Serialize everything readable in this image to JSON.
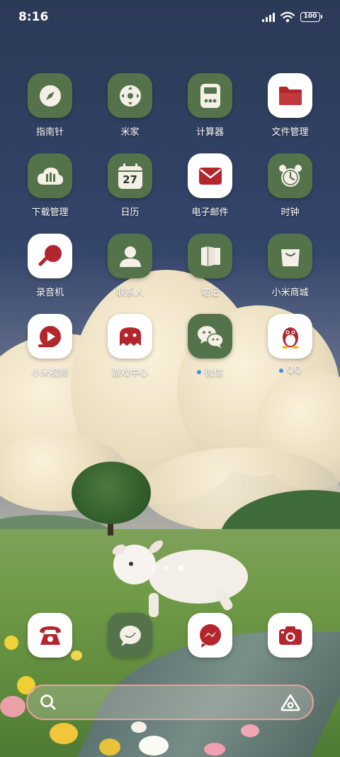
{
  "status_bar": {
    "time": "8:16",
    "battery": "100",
    "icons": [
      "signal-icon",
      "wifi-icon",
      "battery-icon"
    ]
  },
  "apps": [
    {
      "label": "指南针",
      "icon": "compass-icon",
      "style": "green"
    },
    {
      "label": "米家",
      "icon": "mijia-icon",
      "style": "green"
    },
    {
      "label": "计算器",
      "icon": "calculator-icon",
      "style": "green"
    },
    {
      "label": "文件管理",
      "icon": "folder-icon",
      "style": "white"
    },
    {
      "label": "下载管理",
      "icon": "download-cloud-icon",
      "style": "green"
    },
    {
      "label": "日历",
      "icon": "calendar-icon",
      "style": "green",
      "icon_text": "27"
    },
    {
      "label": "电子邮件",
      "icon": "mail-icon",
      "style": "white"
    },
    {
      "label": "时钟",
      "icon": "alarm-clock-icon",
      "style": "green"
    },
    {
      "label": "录音机",
      "icon": "microphone-icon",
      "style": "white"
    },
    {
      "label": "联系人",
      "icon": "contact-icon",
      "style": "green"
    },
    {
      "label": "笔记",
      "icon": "notes-icon",
      "style": "green"
    },
    {
      "label": "小米商城",
      "icon": "shopping-bag-icon",
      "style": "green"
    },
    {
      "label": "小米视频",
      "icon": "video-play-icon",
      "style": "white"
    },
    {
      "label": "游戏中心",
      "icon": "game-ghost-icon",
      "style": "white"
    },
    {
      "label": "微信",
      "icon": "wechat-icon",
      "style": "green",
      "new_dot": true
    },
    {
      "label": "QQ",
      "icon": "qq-penguin-icon",
      "style": "white",
      "new_dot": true
    }
  ],
  "page_indicator": {
    "pages": 2,
    "active_page": 2
  },
  "dock": [
    {
      "icon": "phone-icon",
      "style": "white"
    },
    {
      "icon": "message-bubble-icon",
      "style": "green"
    },
    {
      "icon": "messenger-icon",
      "style": "white"
    },
    {
      "icon": "camera-icon",
      "style": "white"
    }
  ],
  "search_bar": {
    "left_icon": "search-icon",
    "right_icon": "assistant-icon"
  },
  "colors": {
    "accent_red": "#b3262e",
    "icon_green": "#55734a",
    "search_border": "#e7a19b",
    "dot_blue": "#3d8ef0"
  }
}
